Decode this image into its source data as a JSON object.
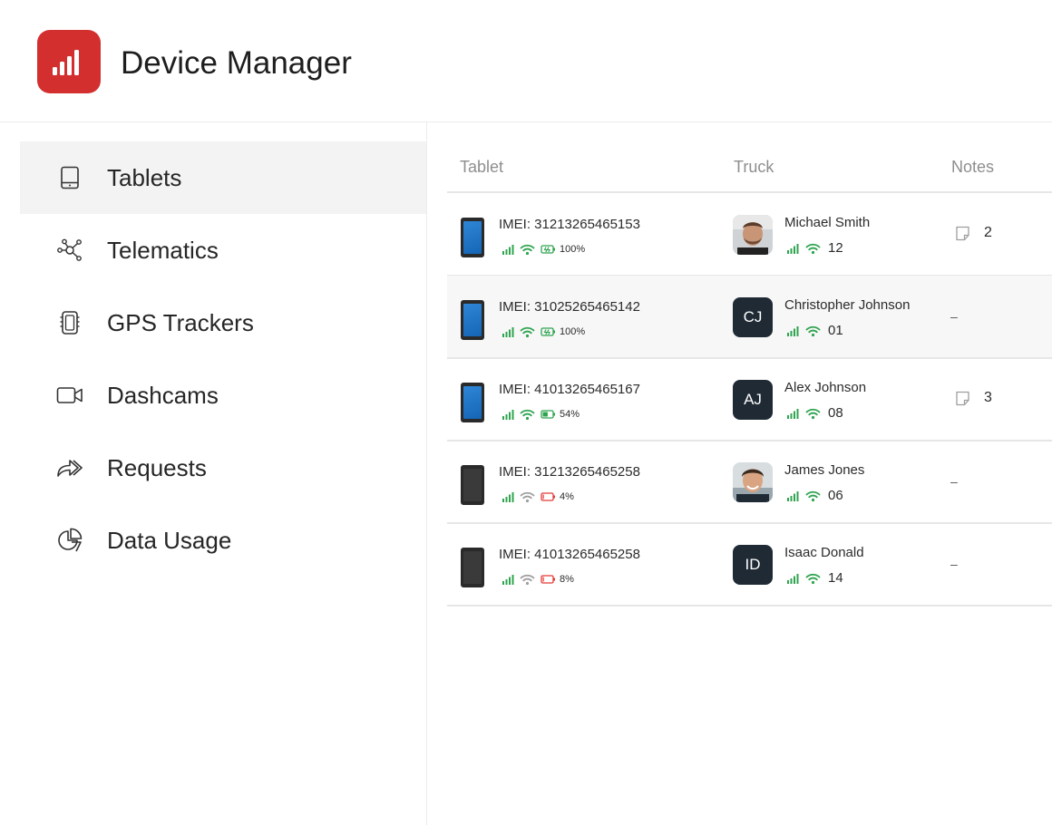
{
  "app": {
    "title": "Device Manager",
    "logo_icon": "signal-bars-icon",
    "brand_color": "#d32f2f"
  },
  "sidebar": {
    "items": [
      {
        "label": "Tablets",
        "icon": "tablet-icon",
        "active": true
      },
      {
        "label": "Telematics",
        "icon": "network-nodes-icon",
        "active": false
      },
      {
        "label": "GPS Trackers",
        "icon": "gps-tracker-icon",
        "active": false
      },
      {
        "label": "Dashcams",
        "icon": "video-camera-icon",
        "active": false
      },
      {
        "label": "Requests",
        "icon": "share-arrow-icon",
        "active": false
      },
      {
        "label": "Data Usage",
        "icon": "pie-chart-icon",
        "active": false
      }
    ]
  },
  "table": {
    "columns": [
      "Tablet",
      "Truck",
      "Notes"
    ],
    "rows": [
      {
        "imei": "IMEI: 31213265465153",
        "tablet_on": true,
        "wifi_on": true,
        "battery": "100%",
        "battery_charging": true,
        "driver": "Michael Smith",
        "avatar": "photo",
        "truck": "12",
        "notes": "2"
      },
      {
        "imei": "IMEI: 31025265465142",
        "tablet_on": true,
        "wifi_on": true,
        "battery": "100%",
        "battery_charging": true,
        "driver": "Christopher Johnson",
        "avatar": "CJ",
        "truck": "01",
        "notes": "–"
      },
      {
        "imei": "IMEI: 41013265465167",
        "tablet_on": true,
        "wifi_on": true,
        "battery": "54%",
        "battery_charging": false,
        "driver": "Alex Johnson",
        "avatar": "AJ",
        "truck": "08",
        "notes": "3"
      },
      {
        "imei": "IMEI: 31213265465258",
        "tablet_on": false,
        "wifi_on": false,
        "battery": "4%",
        "battery_charging": false,
        "driver": "James Jones",
        "avatar": "photo",
        "truck": "06",
        "notes": "–"
      },
      {
        "imei": "IMEI: 41013265465258",
        "tablet_on": false,
        "wifi_on": false,
        "battery": "8%",
        "battery_charging": false,
        "driver": "Isaac Donald",
        "avatar": "ID",
        "truck": "14",
        "notes": "–"
      }
    ]
  },
  "colors": {
    "ok": "#2ea44f",
    "low": "#e53935",
    "muted": "#9e9e9e",
    "avatar_bg": "#1f2a35"
  }
}
